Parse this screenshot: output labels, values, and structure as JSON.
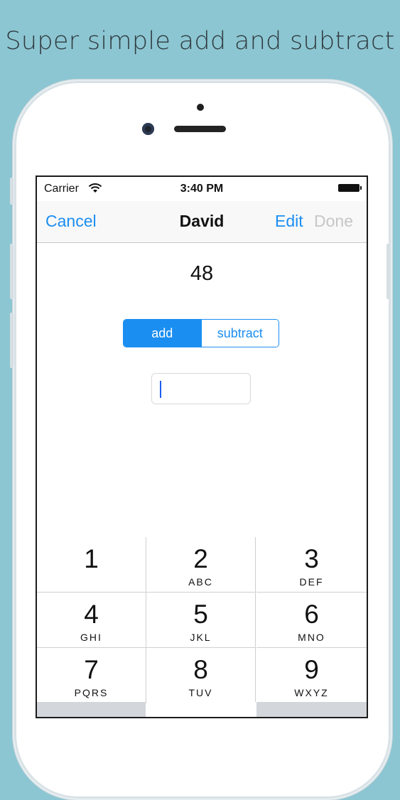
{
  "headline": "Super simple add and subtract",
  "status_bar": {
    "carrier": "Carrier",
    "time": "3:40 PM"
  },
  "navbar": {
    "cancel": "Cancel",
    "title": "David",
    "edit": "Edit",
    "done": "Done"
  },
  "total_value": "48",
  "mode_segments": {
    "add": "add",
    "subtract": "subtract",
    "selected": "add"
  },
  "amount_input": {
    "value": ""
  },
  "keypad": [
    {
      "num": "1",
      "letters": ""
    },
    {
      "num": "2",
      "letters": "ABC"
    },
    {
      "num": "3",
      "letters": "DEF"
    },
    {
      "num": "4",
      "letters": "GHI"
    },
    {
      "num": "5",
      "letters": "JKL"
    },
    {
      "num": "6",
      "letters": "MNO"
    },
    {
      "num": "7",
      "letters": "PQRS"
    },
    {
      "num": "8",
      "letters": "TUV"
    },
    {
      "num": "9",
      "letters": "WXYZ"
    }
  ],
  "colors": {
    "background": "#8cc6d2",
    "accent": "#1b8ef2",
    "disabled": "#c6c6c6"
  }
}
